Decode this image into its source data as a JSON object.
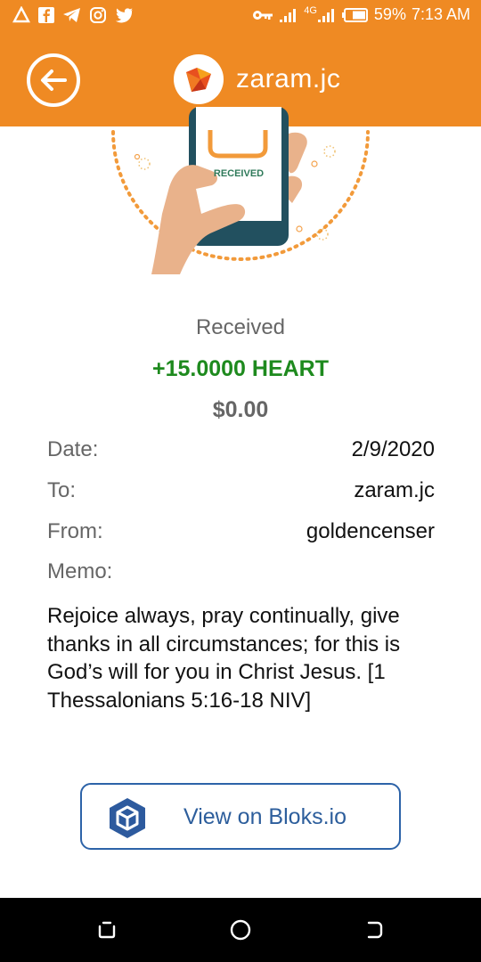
{
  "status_bar": {
    "network": "4G",
    "battery": "59%",
    "time": "7:13 AM"
  },
  "app_bar": {
    "title": "zaram.jc"
  },
  "illustration": {
    "phone_label": "RECEIVED"
  },
  "summary": {
    "label": "Received",
    "amount": "+15.0000 HEART",
    "usd": "$0.00"
  },
  "details": {
    "date_label": "Date:",
    "date_value": "2/9/2020",
    "to_label": "To:",
    "to_value": "zaram.jc",
    "from_label": "From:",
    "from_value": "goldencenser",
    "memo_label": "Memo:",
    "memo_text": "Rejoice always, pray continually, give thanks in all circumstances; for this is God’s will for you in Christ Jesus. [1 Thessalonians 5:16-18 NIV]"
  },
  "action": {
    "label": "View on Bloks.io"
  },
  "colors": {
    "accent": "#ef8a23",
    "positive": "#1e8a1e",
    "link": "#2d5e9c"
  }
}
